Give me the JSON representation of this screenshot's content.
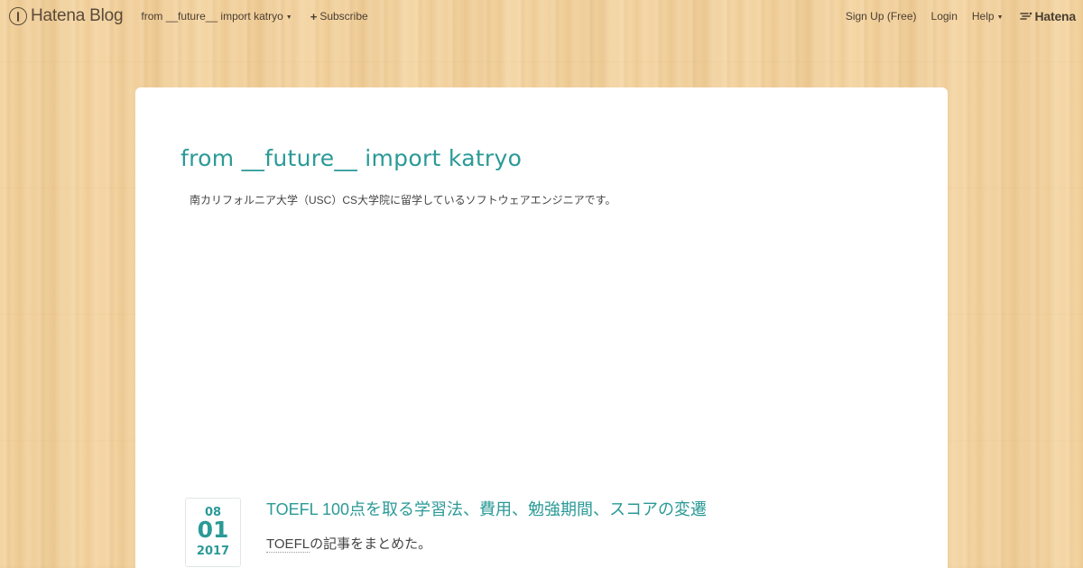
{
  "header": {
    "logo_text": "Hatena Blog",
    "blog_menu": "from __future__ import katryo",
    "subscribe": "Subscribe",
    "signup": "Sign Up (Free)",
    "login": "Login",
    "help": "Help",
    "hatena": "Hatena"
  },
  "blog": {
    "title": "from __future__ import katryo",
    "description": "南カリフォルニア大学（USC）CS大学院に留学しているソフトウェアエンジニアです。"
  },
  "entry": {
    "date_month": "08",
    "date_day": "01",
    "date_year": "2017",
    "title": "TOEFL 100点を取る学習法、費用、勉強期間、スコアの変遷",
    "summary_keyword": "TOEFL",
    "summary_rest": "の記事をまとめた。"
  },
  "colors": {
    "accent": "#2b9a97",
    "background": "#f3d3a0"
  },
  "icons": [
    "hatena-blog-logo-icon",
    "caret-down-icon",
    "plus-icon",
    "hatena-logo-icon"
  ]
}
